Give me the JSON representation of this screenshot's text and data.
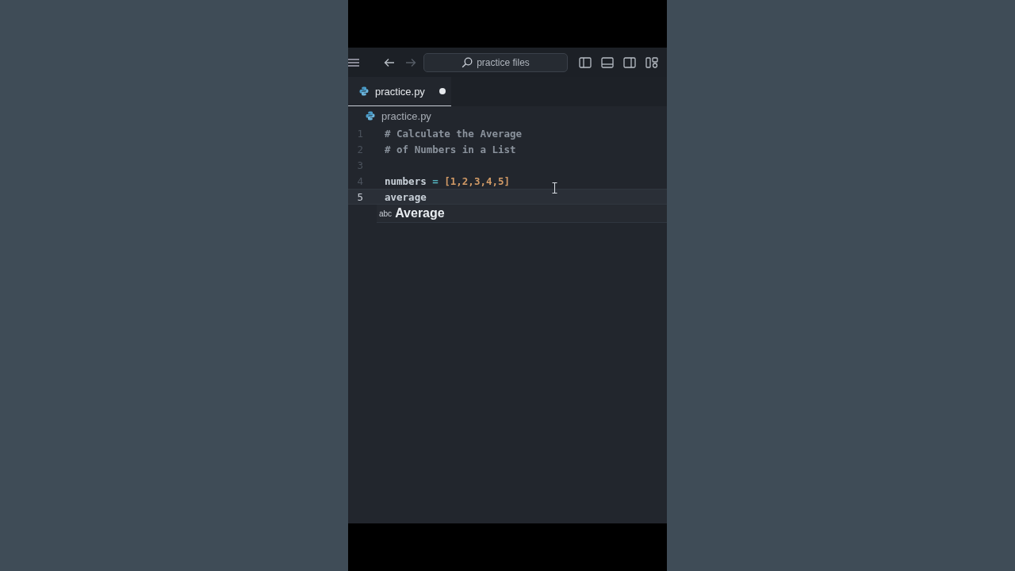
{
  "title_bar": {
    "search": "practice files",
    "back_enabled": true,
    "forward_enabled": false
  },
  "tabs": [
    {
      "label": "practice.py",
      "selected": true,
      "modified": true
    }
  ],
  "breadcrumb": "practice.py",
  "lines": [
    {
      "number": "1",
      "active": false,
      "tokens": [
        {
          "kind": "comment",
          "text": "# Calculate the Average"
        }
      ]
    },
    {
      "number": "2",
      "active": false,
      "tokens": [
        {
          "kind": "comment",
          "text": "# of Numbers in a List"
        }
      ]
    },
    {
      "number": "3",
      "active": false
    },
    {
      "number": "4",
      "active": false,
      "tokens": [
        {
          "kind": "ident",
          "text": "numbers"
        },
        {
          "kind": "op",
          "text": " = "
        },
        {
          "kind": "literal",
          "text": "[1,2,3,4,5]"
        }
      ]
    },
    {
      "number": "5",
      "active": true,
      "tokens": [
        {
          "kind": "ident",
          "text": "average"
        }
      ]
    }
  ],
  "suggestion": {
    "kind_label": "abc",
    "text": "Average"
  }
}
